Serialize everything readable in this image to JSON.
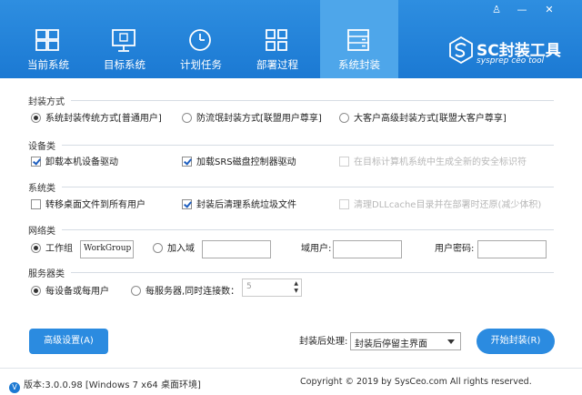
{
  "window_controls": {
    "user": "♙",
    "min": "—",
    "close": "✕"
  },
  "tabs": [
    {
      "label": "当前系统",
      "icon": "windows-icon"
    },
    {
      "label": "目标系统",
      "icon": "monitor-icon"
    },
    {
      "label": "计划任务",
      "icon": "clock-icon"
    },
    {
      "label": "部署过程",
      "icon": "grid-icon"
    },
    {
      "label": "系统封装",
      "icon": "package-icon"
    }
  ],
  "brand": {
    "name": "SC封装工具",
    "subtitle": "sysprep ceo tool"
  },
  "sections": {
    "mode": {
      "title": "封装方式",
      "options": [
        {
          "label": "系统封装传统方式[普通用户]",
          "selected": true
        },
        {
          "label": "防流氓封装方式[联盟用户尊享]",
          "selected": false
        },
        {
          "label": "大客户高级封装方式[联盟大客户尊享]",
          "selected": false
        }
      ]
    },
    "devices": {
      "title": "设备类",
      "options": [
        {
          "label": "卸载本机设备驱动",
          "checked": true,
          "disabled": false
        },
        {
          "label": "加载SRS磁盘控制器驱动",
          "checked": true,
          "disabled": false
        },
        {
          "label": "在目标计算机系统中生成全新的安全标识符",
          "checked": false,
          "disabled": true
        }
      ]
    },
    "system": {
      "title": "系统类",
      "options": [
        {
          "label": "转移桌面文件到所有用户",
          "checked": false,
          "disabled": false
        },
        {
          "label": "封装后清理系统垃圾文件",
          "checked": true,
          "disabled": false
        },
        {
          "label": "清理DLLcache目录并在部署时还原(减少体积)",
          "checked": false,
          "disabled": true
        }
      ]
    },
    "network": {
      "title": "网络类",
      "workgroup_label": "工作组",
      "workgroup_value": "WorkGroup",
      "domain_label": "加入域",
      "domain_value": "",
      "domain_user_label": "域用户:",
      "domain_user_value": "",
      "user_password_label": "用户密码:",
      "user_password_value": ""
    },
    "server": {
      "title": "服务器类",
      "opt1": "每设备或每用户",
      "opt2": "每服务器,同时连接数：",
      "connections": "5"
    }
  },
  "actions": {
    "advanced": "高级设置(A)",
    "after_label": "封装后处理:",
    "after_value": "封装后停留主界面",
    "start": "开始封装(R)"
  },
  "status": {
    "version": "版本:3.0.0.98 [Windows 7 x64 桌面环境]",
    "copyright": "Copyright © 2019 by SysCeo.com All rights reserved."
  }
}
